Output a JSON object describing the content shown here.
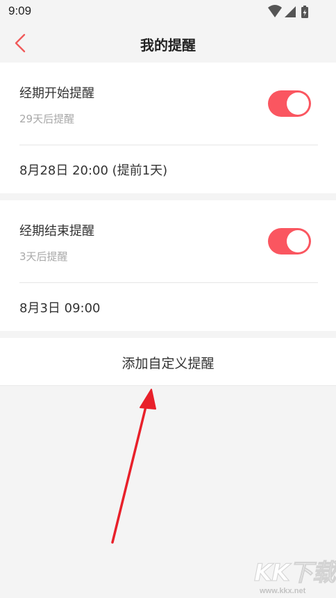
{
  "status_bar": {
    "time": "9:09",
    "icons": [
      "wifi-icon",
      "signal-icon",
      "battery-charging-icon"
    ]
  },
  "nav": {
    "title": "我的提醒",
    "back_icon": "chevron-left-icon"
  },
  "reminders": [
    {
      "title": "经期开始提醒",
      "subtitle": "29天后提醒",
      "enabled": true,
      "time": "8月28日 20:00 (提前1天)"
    },
    {
      "title": "经期结束提醒",
      "subtitle": "3天后提醒",
      "enabled": true,
      "time": "8月3日 09:00"
    }
  ],
  "add_custom": {
    "label": "添加自定义提醒"
  },
  "watermark": {
    "text": "KK下载",
    "url": "www.kkx.net"
  },
  "colors": {
    "accent": "#fa5660",
    "background": "#f4f4f4",
    "card": "#ffffff",
    "annotation_arrow": "#e8202a"
  }
}
